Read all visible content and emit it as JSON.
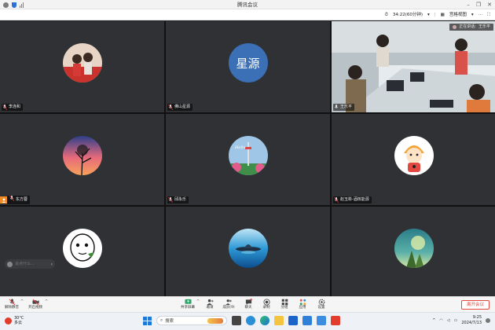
{
  "window": {
    "title": "腾讯会议",
    "controls": [
      "–",
      "❐",
      "✕"
    ]
  },
  "topbar": {
    "timer": "34:22(60分钟)",
    "view_label": "宫格视图"
  },
  "participants": [
    {
      "name": "李连和",
      "type": "photo"
    },
    {
      "name": "佛山星源",
      "type": "text",
      "avatar_text": "星源"
    },
    {
      "name": "王乐平",
      "type": "video",
      "speaking_label": "正在讲话:",
      "speaking_name": "王乐平"
    },
    {
      "name": "东方蓉",
      "type": "photo",
      "host": true
    },
    {
      "name": "邱永乐",
      "type": "photo"
    },
    {
      "name": "赵玉彬-酒核能源",
      "type": "photo"
    },
    {
      "name": "",
      "type": "photo"
    },
    {
      "name": "",
      "type": "photo"
    },
    {
      "name": "",
      "type": "photo"
    }
  ],
  "chat": {
    "placeholder": "说点什么..."
  },
  "toolbar": {
    "mute": "解除静音",
    "video": "开启视频",
    "share": "共享屏幕",
    "invite": "邀请",
    "members": "成员(9)",
    "chat": "聊天",
    "record": "录制",
    "breakout": "分组",
    "apps": "应用",
    "settings": "设置",
    "leave": "离开会议"
  },
  "taskbar": {
    "temp": "30°C",
    "weather": "多云",
    "search": "搜索",
    "time": "9:25",
    "date": "2024/7/13"
  },
  "colors": {
    "accent": "#27c47a",
    "host": "#f08a24",
    "leave": "#e34a3f",
    "text_avatar": "#3b6fb6"
  }
}
